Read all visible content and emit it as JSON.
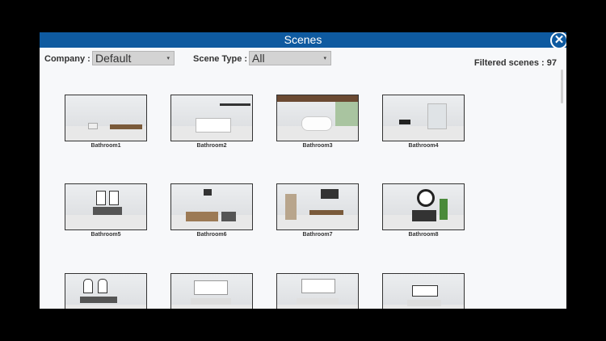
{
  "dialog": {
    "title": "Scenes",
    "close_label": "✕",
    "company_label": "Company :",
    "company_value": "Default",
    "scene_type_label": "Scene Type :",
    "scene_type_value": "All",
    "filtered_text": "Filtered scenes : 97"
  },
  "scenes": [
    {
      "name": "Bathroom1"
    },
    {
      "name": "Bathroom2"
    },
    {
      "name": "Bathroom3"
    },
    {
      "name": "Bathroom4"
    },
    {
      "name": "Bathroom5"
    },
    {
      "name": "Bathroom6"
    },
    {
      "name": "Bathroom7"
    },
    {
      "name": "Bathroom8"
    },
    {
      "name": ""
    },
    {
      "name": ""
    },
    {
      "name": ""
    },
    {
      "name": ""
    }
  ],
  "colors": {
    "titlebar": "#0e5aa0",
    "background": "#f7f8fa"
  }
}
